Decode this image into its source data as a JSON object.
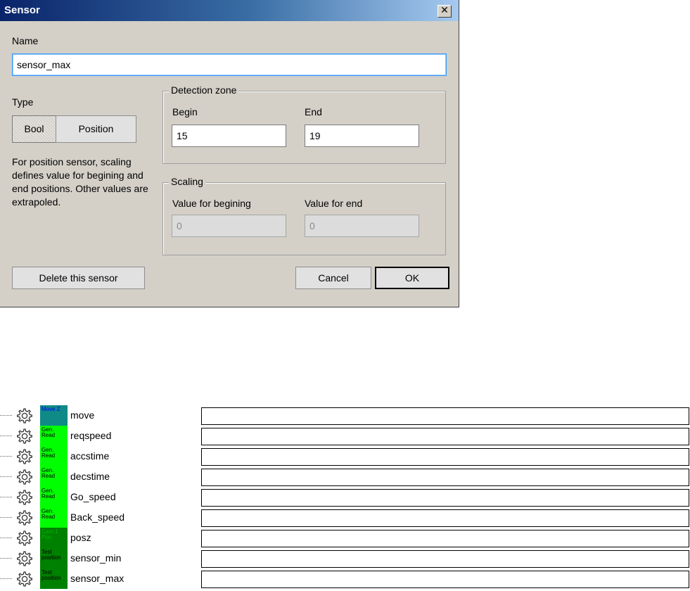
{
  "dialog": {
    "title": "Sensor",
    "close_symbol": "✕",
    "name_label": "Name",
    "name_value": "sensor_max",
    "type_label": "Type",
    "type_bool": "Bool",
    "type_position": "Position",
    "type_selected": "Bool",
    "description": "For position sensor, scaling defines value for begining and end positions. Other values are extrapoled.",
    "detection": {
      "legend": "Detection zone",
      "begin_label": "Begin",
      "begin_value": "15",
      "end_label": "End",
      "end_value": "19"
    },
    "scaling": {
      "legend": "Scaling",
      "begin_label": "Value for begining",
      "begin_value": "0",
      "end_label": "Value for end",
      "end_value": "0"
    },
    "delete_label": "Delete this sensor",
    "cancel_label": "Cancel",
    "ok_label": "OK"
  },
  "list": {
    "icon": "gear-icon",
    "items": [
      {
        "block": "Move Z",
        "kind": "move",
        "name": "move"
      },
      {
        "block": "Gen. Read",
        "kind": "read",
        "name": "reqspeed"
      },
      {
        "block": "Gen. Read",
        "kind": "read",
        "name": "accstime"
      },
      {
        "block": "Gen. Read",
        "kind": "read",
        "name": "decstime"
      },
      {
        "block": "Gen. Read",
        "kind": "read",
        "name": "Go_speed"
      },
      {
        "block": "Gen. Read",
        "kind": "read",
        "name": "Back_speed"
      },
      {
        "block": "Cam 1 Pos",
        "kind": "comp",
        "name": "posz"
      },
      {
        "block": "Test position",
        "kind": "test",
        "name": "sensor_min"
      },
      {
        "block": "Test position",
        "kind": "test",
        "name": "sensor_max"
      }
    ]
  }
}
